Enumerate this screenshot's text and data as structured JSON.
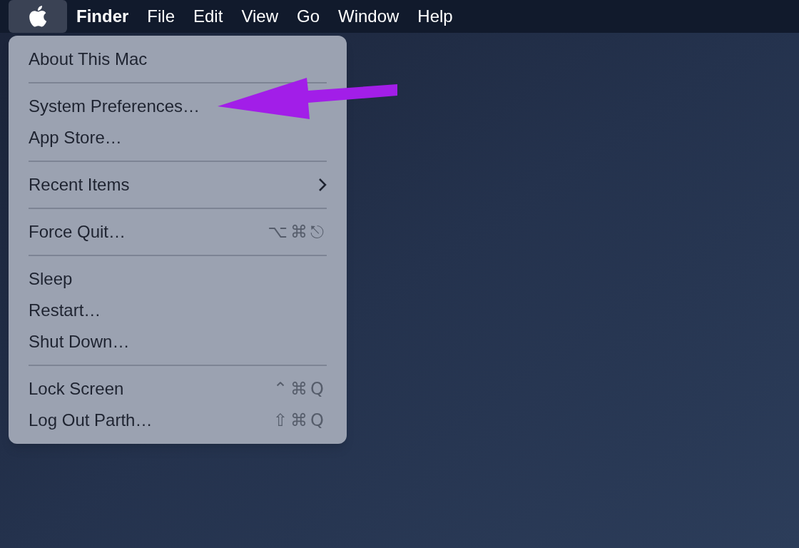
{
  "menu_bar": {
    "apple_menu_selected": true,
    "items": [
      {
        "label": "Finder",
        "kind": "app"
      },
      {
        "label": "File",
        "kind": "menu"
      },
      {
        "label": "Edit",
        "kind": "menu"
      },
      {
        "label": "View",
        "kind": "menu"
      },
      {
        "label": "Go",
        "kind": "menu"
      },
      {
        "label": "Window",
        "kind": "menu"
      },
      {
        "label": "Help",
        "kind": "menu"
      }
    ]
  },
  "apple_menu": {
    "items": [
      {
        "kind": "item",
        "label": "About This Mac"
      },
      {
        "kind": "separator"
      },
      {
        "kind": "item",
        "label": "System Preferences…"
      },
      {
        "kind": "item",
        "label": "App Store…"
      },
      {
        "kind": "separator"
      },
      {
        "kind": "submenu",
        "label": "Recent Items"
      },
      {
        "kind": "separator"
      },
      {
        "kind": "item",
        "label": "Force Quit…",
        "shortcut": "⌥⌘⎋"
      },
      {
        "kind": "separator"
      },
      {
        "kind": "item",
        "label": "Sleep"
      },
      {
        "kind": "item",
        "label": "Restart…"
      },
      {
        "kind": "item",
        "label": "Shut Down…"
      },
      {
        "kind": "separator"
      },
      {
        "kind": "item",
        "label": "Lock Screen",
        "shortcut": "⌃⌘Q"
      },
      {
        "kind": "item",
        "label": "Log Out Parth…",
        "shortcut": "⇧⌘Q"
      }
    ]
  },
  "annotation": {
    "kind": "arrow"
  }
}
